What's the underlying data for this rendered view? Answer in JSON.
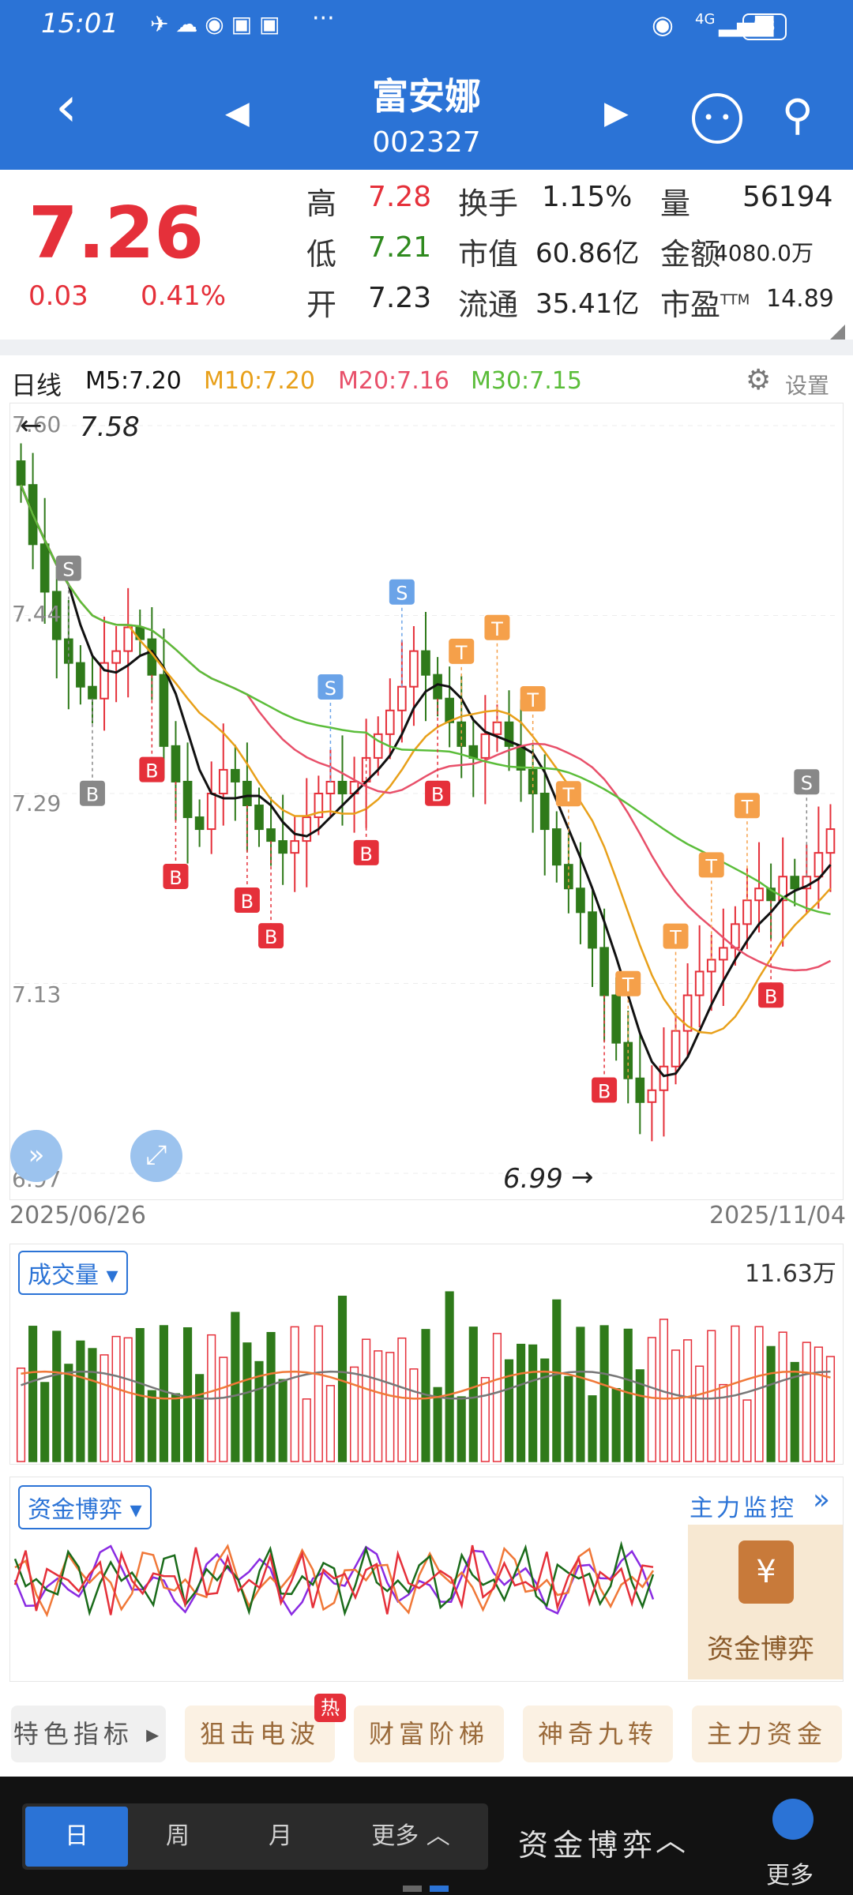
{
  "status": {
    "time": "15:01",
    "signal": "4G",
    "battery": "93",
    "more": "···"
  },
  "header": {
    "title": "富安娜",
    "code": "002327"
  },
  "quote": {
    "price": "7.26",
    "change": "0.03",
    "change_pct": "0.41%",
    "rows": [
      [
        {
          "label": "高",
          "value": "7.28",
          "tone": "red"
        },
        {
          "label": "换手",
          "value": "1.15%"
        },
        {
          "label": "量",
          "value": "56194"
        }
      ],
      [
        {
          "label": "低",
          "value": "7.21",
          "tone": "green"
        },
        {
          "label": "市值",
          "value": "60.86亿"
        },
        {
          "label": "金额",
          "value": "4080.0万"
        }
      ],
      [
        {
          "label": "开",
          "value": "7.23",
          "tone": "dark"
        },
        {
          "label": "流通",
          "value": "35.41亿"
        },
        {
          "label": "市盈",
          "sup": "TTM",
          "value": "14.89"
        }
      ]
    ]
  },
  "ma": {
    "period": "日线",
    "m5": "M5:7.20",
    "m10": "M10:7.20",
    "m20": "M20:7.16",
    "m30": "M30:7.15",
    "settings": "设置",
    "colors": {
      "m5": "#111111",
      "m10": "#e8a01a",
      "m20": "#e8506a",
      "m30": "#5bbd3a"
    }
  },
  "kline": {
    "y_ticks": [
      "7.60",
      "7.44",
      "7.29",
      "7.13",
      "6.97"
    ],
    "y_values": [
      7.6,
      7.44,
      7.29,
      7.13,
      6.97
    ],
    "date_start": "2025/06/26",
    "date_end": "2025/11/04",
    "note_high": "7.58",
    "note_low": "6.99",
    "high_mark": 7.58,
    "low_mark": 6.99
  },
  "volume": {
    "label": "成交量",
    "max_label": "11.63万"
  },
  "flow": {
    "label": "资金博弈",
    "monitor": "主力监控",
    "promo": "资金博弈"
  },
  "features": [
    "特色指标",
    "狙击电波",
    "财富阶梯",
    "神奇九转",
    "主力资金"
  ],
  "hot_badge": "热",
  "periods": [
    "日",
    "周",
    "月",
    "更多"
  ],
  "bottom": {
    "indicator": "资金博弈",
    "more": "更多"
  },
  "chart_data": {
    "type": "candlestick",
    "x_range": [
      "2025/06/26",
      "2025/11/04"
    ],
    "ylim": [
      6.97,
      7.6
    ],
    "annotated_high": 7.58,
    "annotated_low": 6.99,
    "close_approx": [
      7.55,
      7.5,
      7.46,
      7.42,
      7.4,
      7.38,
      7.37,
      7.4,
      7.41,
      7.43,
      7.42,
      7.39,
      7.33,
      7.3,
      7.27,
      7.26,
      7.29,
      7.31,
      7.3,
      7.28,
      7.26,
      7.25,
      7.24,
      7.25,
      7.27,
      7.29,
      7.3,
      7.29,
      7.3,
      7.32,
      7.34,
      7.36,
      7.38,
      7.41,
      7.39,
      7.37,
      7.35,
      7.33,
      7.32,
      7.34,
      7.35,
      7.33,
      7.31,
      7.29,
      7.26,
      7.23,
      7.21,
      7.19,
      7.16,
      7.12,
      7.08,
      7.05,
      7.03,
      7.04,
      7.06,
      7.09,
      7.12,
      7.14,
      7.15,
      7.16,
      7.18,
      7.2,
      7.21,
      7.2,
      7.22,
      7.21,
      7.22,
      7.24,
      7.26
    ]
  }
}
